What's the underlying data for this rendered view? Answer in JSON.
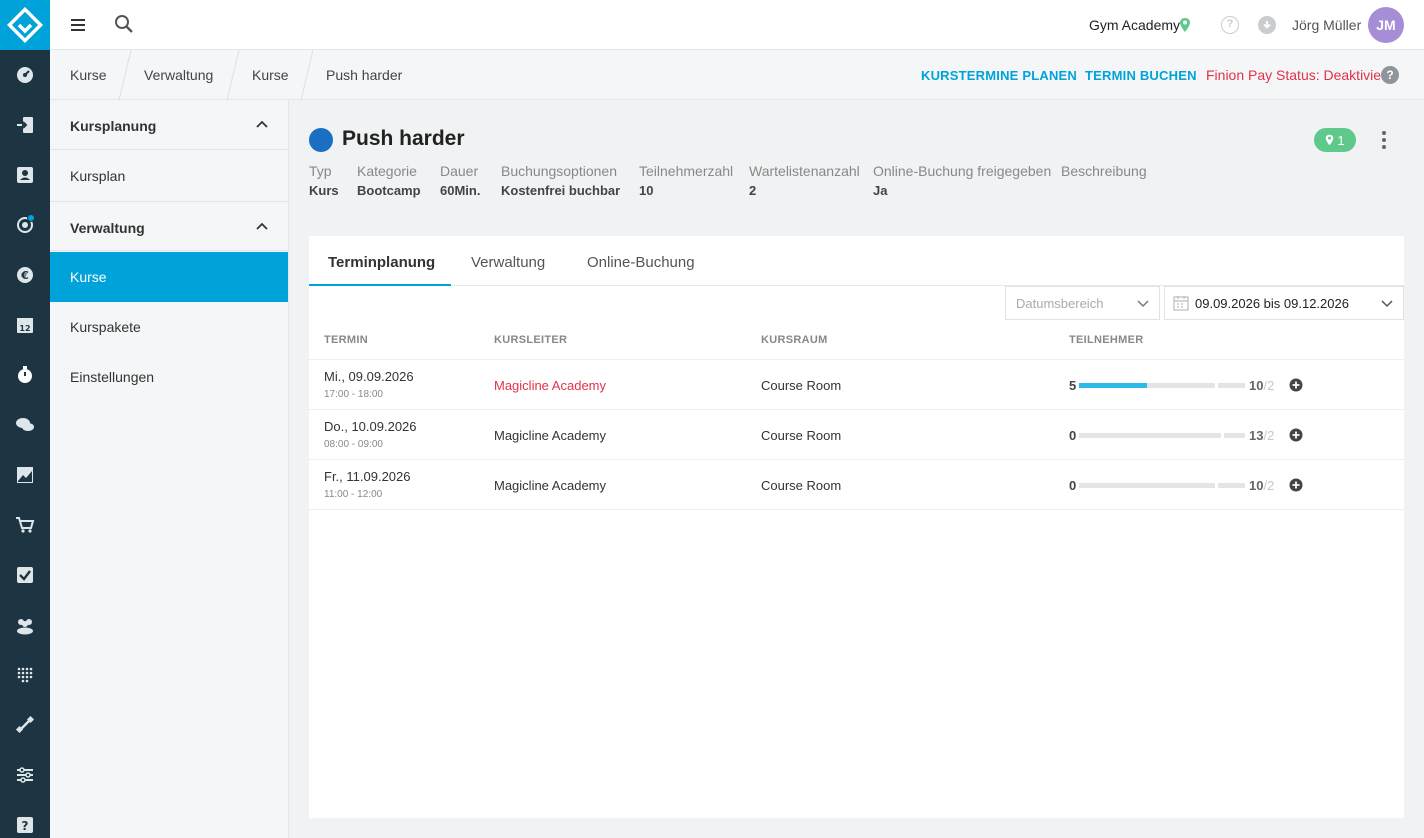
{
  "header": {
    "studio_name": "Gym Academy",
    "user_name": "Jörg Müller",
    "avatar_initials": "JM",
    "help_glyph": "?"
  },
  "breadcrumb": {
    "items": [
      "Kurse",
      "Verwaltung",
      "Kurse",
      "Push harder"
    ]
  },
  "actions": {
    "plan_label": "KURSTERMINE PLANEN",
    "book_label": "TERMIN BUCHEN",
    "finion_status": "Finion Pay Status: Deaktiviert",
    "finion_help": "?"
  },
  "sidebar": {
    "groups": [
      {
        "title": "Kursplanung",
        "items": [
          "Kursplan"
        ]
      },
      {
        "title": "Verwaltung",
        "items": [
          "Kurse",
          "Kurspakete",
          "Einstellungen"
        ]
      }
    ],
    "active_item": "Kurse"
  },
  "course": {
    "title": "Push harder",
    "color": "#1a6fc0",
    "location_count": "1",
    "meta": [
      {
        "label": "Typ",
        "value": "Kurs"
      },
      {
        "label": "Kategorie",
        "value": "Bootcamp"
      },
      {
        "label": "Dauer",
        "value": "60Min."
      },
      {
        "label": "Buchungsoptionen",
        "value": "Kostenfrei buchbar"
      },
      {
        "label": "Teilnehmerzahl",
        "value": "10"
      },
      {
        "label": "Wartelistenanzahl",
        "value": "2"
      },
      {
        "label": "Online-Buchung freigegeben",
        "value": "Ja"
      },
      {
        "label": "Beschreibung",
        "value": ""
      }
    ]
  },
  "tabs": [
    {
      "label": "Terminplanung",
      "active": true
    },
    {
      "label": "Verwaltung",
      "active": false
    },
    {
      "label": "Online-Buchung",
      "active": false
    }
  ],
  "filters": {
    "range_placeholder": "Datumsbereich",
    "date_range": "09.09.2026 bis 09.12.2026"
  },
  "table": {
    "columns": [
      "TERMIN",
      "KURSLEITER",
      "KURSRAUM",
      "TEILNEHMER"
    ],
    "rows": [
      {
        "date": "Mi., 09.09.2026",
        "time": "17:00 - 18:00",
        "leader": "Magicline Academy",
        "leader_highlight": true,
        "room": "Course Room",
        "booked": "5",
        "capacity": "10",
        "waitlist": "/2",
        "fill": 0.5
      },
      {
        "date": "Do., 10.09.2026",
        "time": "08:00 - 09:00",
        "leader": "Magicline Academy",
        "leader_highlight": false,
        "room": "Course Room",
        "booked": "0",
        "capacity": "13",
        "waitlist": "/2",
        "fill": 0
      },
      {
        "date": "Fr., 11.09.2026",
        "time": "11:00 - 12:00",
        "leader": "Magicline Academy",
        "leader_highlight": false,
        "room": "Course Room",
        "booked": "0",
        "capacity": "10",
        "waitlist": "/2",
        "fill": 0
      }
    ]
  },
  "colors": {
    "accent": "#00a3d9",
    "rail": "#1d3542",
    "alert": "#e0324b",
    "success": "#5ec98a"
  },
  "icons": {
    "rail": [
      "dashboard-icon",
      "check-in-icon",
      "customer-card-icon",
      "marketing-icon",
      "finance-icon",
      "calendar-icon",
      "courses-icon",
      "chat-icon",
      "statistics-icon",
      "shop-icon",
      "tasks-icon",
      "groups-icon",
      "devices-icon",
      "equipment-icon",
      "settings-icon",
      "help-icon"
    ]
  }
}
